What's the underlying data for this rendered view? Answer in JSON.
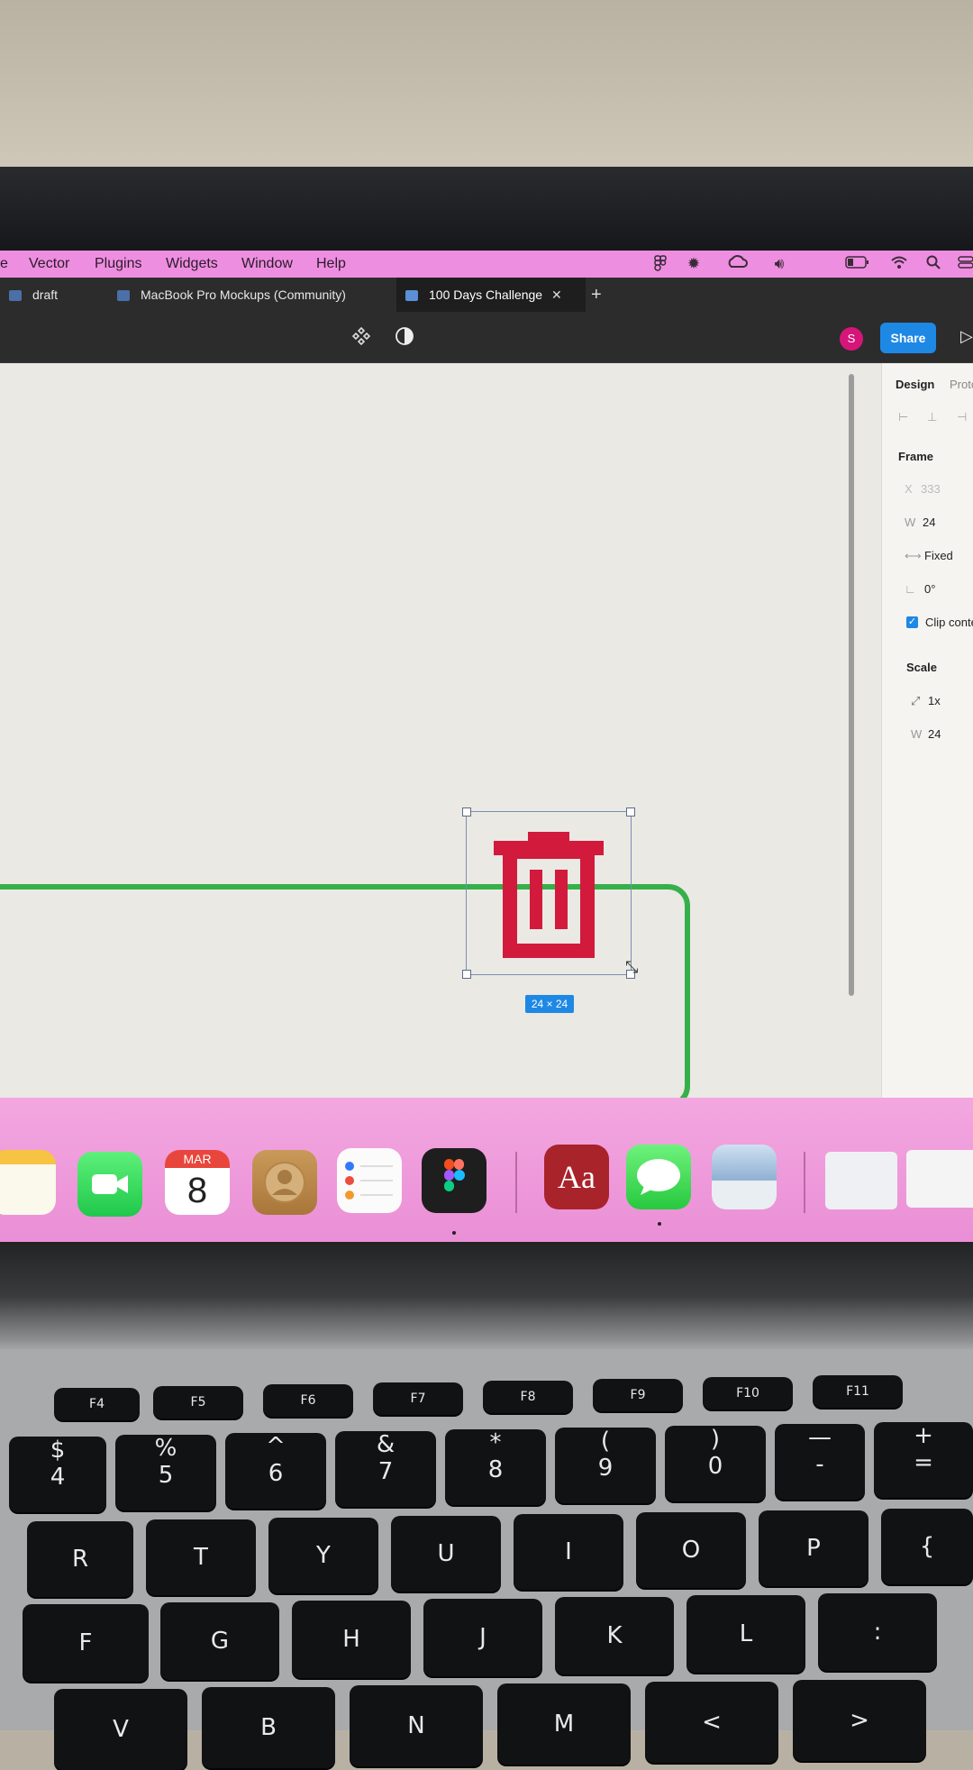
{
  "menubar": {
    "items": [
      "e",
      "Vector",
      "Plugins",
      "Widgets",
      "Window",
      "Help"
    ],
    "status_icons": [
      "figma-menubar-icon",
      "brightness-icon",
      "creative-cloud-icon",
      "volume-icon",
      "battery-icon",
      "wifi-icon",
      "search-icon",
      "control-center-icon"
    ]
  },
  "tabs": [
    {
      "label": "draft",
      "active": false
    },
    {
      "label": "MacBook Pro Mockups (Community)",
      "active": false
    },
    {
      "label": "100 Days Challenge",
      "active": true
    }
  ],
  "tab_close": "✕",
  "tab_add": "+",
  "toolbar": {
    "avatar_initial": "S",
    "share_label": "Share",
    "play_icon": "▷"
  },
  "selection": {
    "size_badge": "24 × 24"
  },
  "panel": {
    "tab_design": "Design",
    "tab_prototype": "Prototyp",
    "frame_label": "Frame",
    "x_label": "X",
    "x_value": "333",
    "w_label": "W",
    "w_value": "24",
    "resize_label": "Fixed",
    "rotation_value": "0°",
    "clip_label": "Clip content",
    "clip_checked": true,
    "scale_label": "Scale",
    "scale_value": "1x",
    "scale_w_label": "W",
    "scale_w_value": "24"
  },
  "dock": {
    "calendar_month": "MAR",
    "calendar_day": "8",
    "dictionary_label": "Aa",
    "apps": [
      "notes",
      "facetime",
      "calendar",
      "contacts",
      "reminders",
      "figma",
      "dictionary",
      "messages",
      "preview"
    ]
  },
  "keyboard": {
    "fn_row": [
      "F4",
      "F5",
      "F6",
      "F7",
      "F8",
      "F9",
      "F10",
      "F11"
    ],
    "number_row": [
      {
        "top": "$",
        "bottom": "4"
      },
      {
        "top": "%",
        "bottom": "5"
      },
      {
        "top": "^",
        "bottom": "6"
      },
      {
        "top": "&",
        "bottom": "7"
      },
      {
        "top": "*",
        "bottom": "8"
      },
      {
        "top": "(",
        "bottom": "9"
      },
      {
        "top": ")",
        "bottom": "0"
      },
      {
        "top": "—",
        "bottom": "-"
      },
      {
        "top": "+",
        "bottom": "="
      }
    ],
    "row_q": [
      "R",
      "T",
      "Y",
      "U",
      "I",
      "O",
      "P",
      "{"
    ],
    "row_a": [
      "F",
      "G",
      "H",
      "J",
      "K",
      "L",
      ":"
    ],
    "row_z": [
      "V",
      "B",
      "N",
      "M",
      "<",
      ">"
    ]
  },
  "colors": {
    "menubar": "#ee8ee0",
    "frame_border": "#35b04a",
    "trash_icon": "#d21a3c",
    "selection": "#1e88e5",
    "share_button": "#1e88e5",
    "avatar": "#d6157a"
  }
}
